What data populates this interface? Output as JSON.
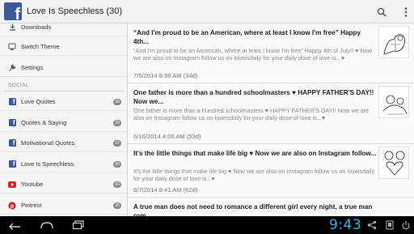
{
  "app": {
    "title": "Love Is Speechless (30)",
    "logo_letter": "f",
    "colors": {
      "facebook_blue": "#3b5998",
      "clock_blue": "#33b5e5",
      "pinterest_red": "#cb2027"
    }
  },
  "actionbar": {
    "search_icon": "search-icon",
    "overflow_icon": "overflow-menu-icon"
  },
  "drawer": {
    "top_items": [
      {
        "label": "Downloads",
        "icon": "download-icon"
      },
      {
        "label": "Switch Theme",
        "icon": "theme-icon"
      },
      {
        "label": "Settings",
        "icon": "wrench-icon"
      }
    ],
    "section_label": "SOCIAL",
    "social_items": [
      {
        "label": "Love Quotes",
        "icon": "facebook-icon",
        "badge": "30"
      },
      {
        "label": "Quotes & Saying",
        "icon": "facebook-icon",
        "badge": "29"
      },
      {
        "label": "Motivational Quotes",
        "icon": "facebook-icon",
        "badge": "27"
      },
      {
        "label": "Love Is Speechless",
        "icon": "facebook-icon",
        "badge": "30"
      },
      {
        "label": "Youtube",
        "icon": "youtube-icon",
        "badge": "50"
      },
      {
        "label": "Pintrest",
        "icon": "pinterest-icon",
        "badge": "25"
      }
    ]
  },
  "posts": [
    {
      "title": "“And I'm proud to be an American, where at least I know I'm free” Happy 4th...",
      "body": "“And I'm proud to be an American, where at least I know I'm free” Happy 4th of July!! ♥ Now we are also on Instagram follow us on loveisdaily for your daily dose of love is...♥",
      "date": "7/5/2014 8:39 AM (34d)"
    },
    {
      "title": "One father is more than a hundred schoolmasters ♥ HAPPY FATHER'S DAY!! Now we...",
      "body": "One father is more than a hundred schoolmasters ♥ HAPPY FATHER'S DAY!! Now we are also on Instagram follow us on loveisdaily for your daily dose of love is...♥",
      "date": "6/16/2014 4:06 AM (53d)"
    },
    {
      "title": "It's the little things that make life big ♥ Now we are also on Instagram follow...",
      "body": "It's the little things that make life big ♥ Now we are also on Instagram follow us on loveisdaily for your daily dose of love is...♥",
      "date": "6/7/2014 8:41 AM (62d)"
    },
    {
      "title": "A true man does not need to romance a different girl every night, a true man rom...",
      "body": "",
      "date": ""
    }
  ],
  "statusbar": {
    "time": "9:43"
  }
}
